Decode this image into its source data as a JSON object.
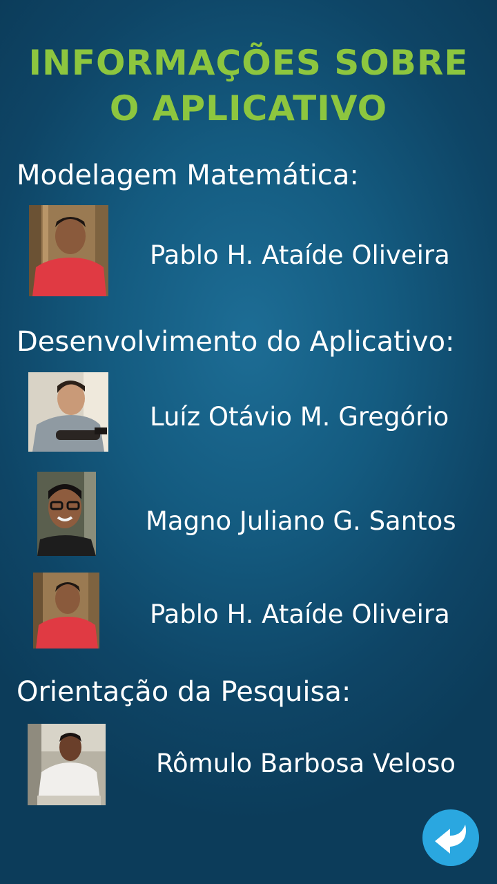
{
  "header": {
    "title_line1": "INFORMAÇÕES SOBRE",
    "title_line2": "O APLICATIVO"
  },
  "sections": [
    {
      "heading": "Modelagem Matemática:",
      "people": [
        {
          "name": "Pablo H. Ataíde Oliveira",
          "photo": "pablo-photo"
        }
      ]
    },
    {
      "heading": "Desenvolvimento do Aplicativo:",
      "people": [
        {
          "name": "Luíz Otávio M. Gregório",
          "photo": "luiz-photo"
        },
        {
          "name": "Magno Juliano G. Santos",
          "photo": "magno-photo"
        },
        {
          "name": "Pablo H. Ataíde Oliveira",
          "photo": "pablo-photo"
        }
      ]
    },
    {
      "heading": "Orientação da Pesquisa:",
      "people": [
        {
          "name": "Rômulo Barbosa Veloso",
          "photo": "romulo-photo"
        }
      ]
    }
  ],
  "back_button": {
    "icon": "back-arrow-icon"
  },
  "colors": {
    "title": "#8dc63f",
    "background": "#145b80",
    "text": "#ffffff",
    "back_button": "#2aa7e0"
  }
}
